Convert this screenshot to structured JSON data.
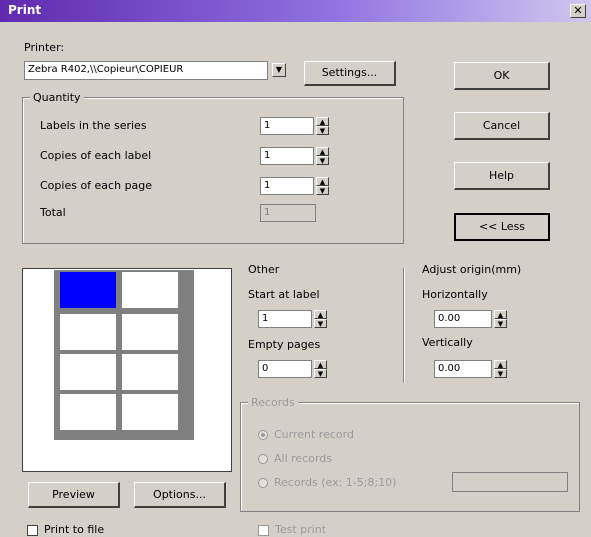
{
  "window": {
    "title": "Print",
    "close_glyph": "✕"
  },
  "printer": {
    "label": "Printer:",
    "value": "Zebra R402,\\\\Copieur\\COPIEUR",
    "settings_label": "Settings..."
  },
  "quantity": {
    "legend": "Quantity",
    "labels_in_series": {
      "label": "Labels in the series",
      "value": "1"
    },
    "copies_each_label": {
      "label": "Copies of each label",
      "value": "1"
    },
    "copies_each_page": {
      "label": "Copies of each page",
      "value": "1"
    },
    "total": {
      "label": "Total",
      "value": "1"
    }
  },
  "buttons": {
    "ok": "OK",
    "cancel": "Cancel",
    "help": "Help",
    "less": "<< Less",
    "preview": "Preview",
    "options": "Options..."
  },
  "other": {
    "legend": "Other",
    "start_at_label": {
      "label": "Start at label",
      "value": "1"
    },
    "empty_pages": {
      "label": "Empty pages",
      "value": "0"
    }
  },
  "adjust": {
    "legend": "Adjust origin(mm)",
    "horizontally": {
      "label": "Horizontally",
      "value": "0.00"
    },
    "vertically": {
      "label": "Vertically",
      "value": "0.00"
    }
  },
  "records": {
    "legend": "Records",
    "current": "Current record",
    "all": "All records",
    "range": "Records (ex: 1-5;8;10)",
    "range_value": ""
  },
  "footer": {
    "print_to_file": "Print to file",
    "test": "Test print"
  },
  "preview_sheet": {
    "rows": 4,
    "cols": 2,
    "selected_cell": 1
  }
}
